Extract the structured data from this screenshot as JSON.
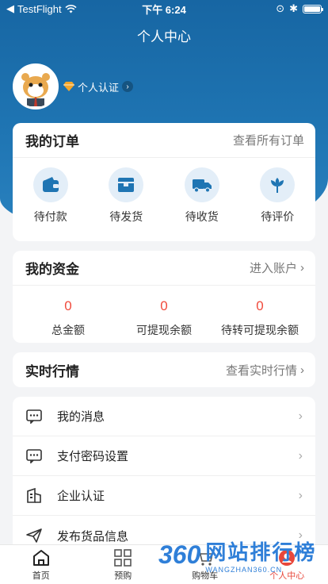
{
  "status_bar": {
    "carrier": "TestFlight",
    "time": "下午 6:24"
  },
  "nav": {
    "title": "个人中心"
  },
  "profile": {
    "cert_label": "个人认证"
  },
  "orders": {
    "title": "我的订单",
    "view_all": "查看所有订单",
    "items": [
      {
        "label": "待付款",
        "icon": "wallet-icon"
      },
      {
        "label": "待发货",
        "icon": "box-icon"
      },
      {
        "label": "待收货",
        "icon": "truck-icon"
      },
      {
        "label": "待评价",
        "icon": "flower-icon"
      }
    ]
  },
  "funds": {
    "title": "我的资金",
    "enter": "进入账户",
    "items": [
      {
        "value": "0",
        "label": "总金额"
      },
      {
        "value": "0",
        "label": "可提现余额"
      },
      {
        "value": "0",
        "label": "待转可提现余额"
      }
    ]
  },
  "market": {
    "title": "实时行情",
    "view": "查看实时行情"
  },
  "menu": [
    {
      "label": "我的消息",
      "icon": "message-icon"
    },
    {
      "label": "支付密码设置",
      "icon": "password-icon"
    },
    {
      "label": "企业认证",
      "icon": "building-icon"
    },
    {
      "label": "发布货品信息",
      "icon": "send-icon"
    }
  ],
  "tabbar": [
    {
      "label": "首页",
      "icon": "home-icon"
    },
    {
      "label": "预购",
      "icon": "grid-icon"
    },
    {
      "label": "购物车",
      "icon": "cart-icon"
    },
    {
      "label": "个人中心",
      "icon": "user-icon"
    }
  ],
  "watermark": {
    "logo": "360",
    "text": "网站排行榜",
    "url": "WANGZHAN360.CN"
  },
  "colors": {
    "primary": "#1766a3",
    "accent_red": "#f04a3c",
    "icon_blue": "#1f75b3"
  }
}
